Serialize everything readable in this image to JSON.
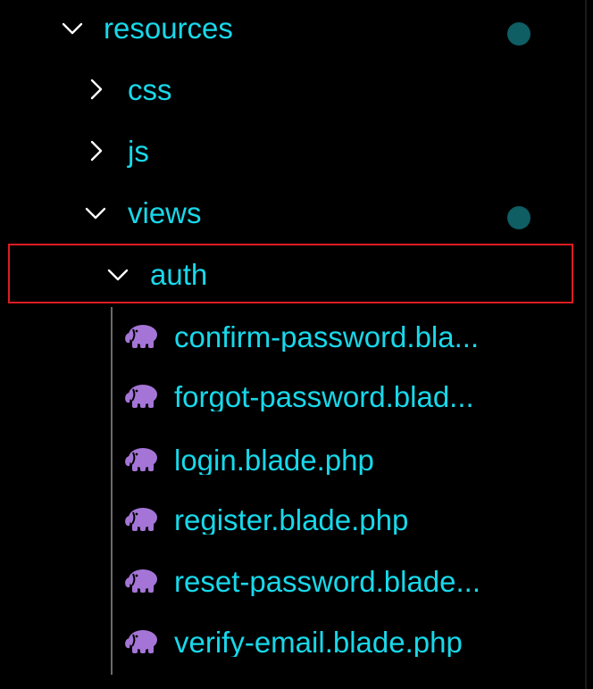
{
  "explorer": {
    "folders": {
      "resources": {
        "label": "resources",
        "expanded": true,
        "modified_dot": true
      },
      "css": {
        "label": "css",
        "expanded": false
      },
      "js": {
        "label": "js",
        "expanded": false
      },
      "views": {
        "label": "views",
        "expanded": true,
        "modified_dot": true
      },
      "auth": {
        "label": "auth",
        "expanded": true,
        "selected": true
      }
    },
    "files": [
      {
        "label": "confirm-password.bla...",
        "icon": "php-elephant-icon"
      },
      {
        "label": "forgot-password.blad...",
        "icon": "php-elephant-icon"
      },
      {
        "label": "login.blade.php",
        "icon": "php-elephant-icon"
      },
      {
        "label": "register.blade.php",
        "icon": "php-elephant-icon"
      },
      {
        "label": "reset-password.blade...",
        "icon": "php-elephant-icon"
      },
      {
        "label": "verify-email.blade.php",
        "icon": "php-elephant-icon"
      }
    ],
    "colors": {
      "background": "#000000",
      "text": "#18d8ea",
      "modified_dot": "#0e5e64",
      "selection_border": "#dd1c22",
      "php_icon": "#a475d6",
      "indent_guide": "#6a6a6a"
    }
  }
}
